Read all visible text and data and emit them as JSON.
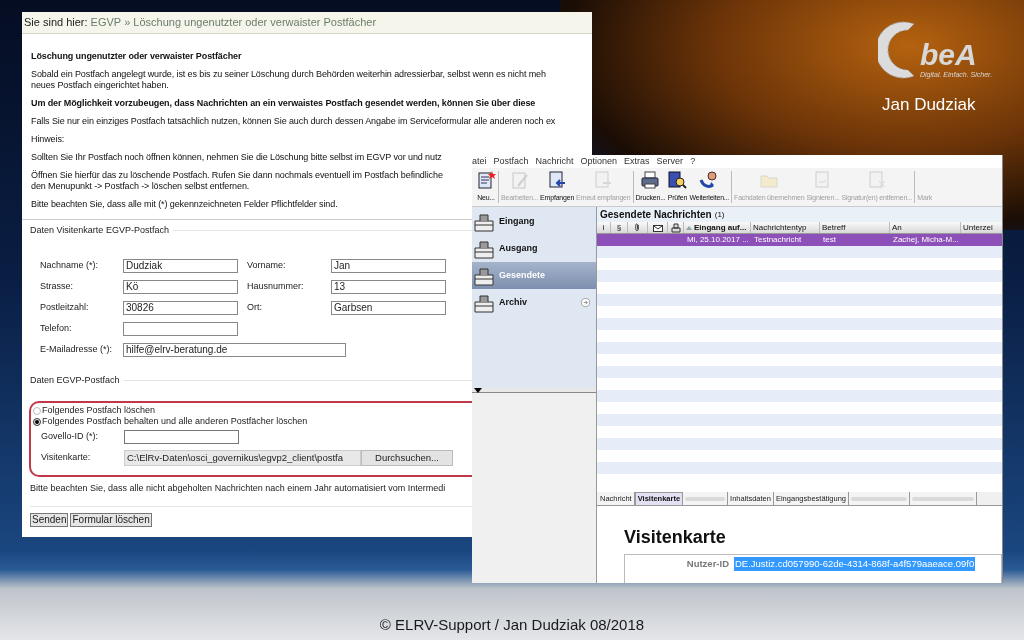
{
  "slide": {
    "logo": {
      "wordmark": "beA",
      "tagline": "Digital. Einfach. Sicher."
    },
    "author": "Jan Dudziak",
    "footer": "© ELRV-Support / Jan Dudziak 08/2018"
  },
  "browser_window": {
    "breadcrumb": {
      "prefix": "Sie sind hier:",
      "separator": "»",
      "items": [
        "EGVP",
        "Löschung ungenutzter oder verwaister Postfächer"
      ]
    },
    "paragraphs": [
      {
        "bold": true,
        "lines": [
          "Löschung ungenutzter oder verwaister Postfächer"
        ]
      },
      {
        "bold": false,
        "lines": [
          "Sobald ein Postfach angelegt wurde, ist es bis zu seiner Löschung durch Behörden weiterhin adressierbar, selbst wenn es nicht meh",
          "neues Postfach eingerichtet haben."
        ]
      },
      {
        "bold": true,
        "lines": [
          "Um der Möglichkeit vorzubeugen, dass Nachrichten an ein verwaistes Postfach gesendet werden, können Sie über diese"
        ]
      },
      {
        "bold": false,
        "lines": [
          "Falls Sie nur ein einziges Postfach tatsächlich nutzen, können Sie auch durch dessen Angabe im Serviceformular alle anderen noch ex"
        ]
      },
      {
        "bold": false,
        "lines": [
          "Hinweis:"
        ]
      },
      {
        "bold": false,
        "lines": [
          "Sollten Sie Ihr Postfach noch öffnen können, nehmen Sie die Löschung bitte selbst im EGVP vor und nutz"
        ]
      },
      {
        "bold": false,
        "lines": [
          "Öffnen Sie hierfür das zu löschende Postfach. Rufen Sie dann nochmals eventuell im Postfach befindliche",
          "den Menupunkt -> Postfach -> löschen selbst entfernen."
        ]
      },
      {
        "bold": false,
        "lines": [
          "Bitte beachten Sie, dass alle mit (*) gekennzeichneten Felder Pflichtfelder sind."
        ]
      }
    ],
    "card_section": {
      "legend": "Daten Visitenkarte EGVP-Postfach",
      "rows": [
        [
          {
            "label": "Nachname (*):",
            "value": "Dudziak"
          },
          {
            "label": "Vorname:",
            "value": "Jan"
          }
        ],
        [
          {
            "label": "Strasse:",
            "value": "Kö"
          },
          {
            "label": "Hausnummer:",
            "value": "13"
          }
        ],
        [
          {
            "label": "Postleitzahl:",
            "value": "30826"
          },
          {
            "label": "Ort:",
            "value": "Garbsen"
          }
        ],
        [
          {
            "label": "Telefon:"
          }
        ],
        [
          {
            "label": "E-Mailadresse (*):",
            "value": "hilfe@elrv-beratung.de",
            "wide": true
          }
        ]
      ]
    },
    "mailbox_section": {
      "legend": "Daten EGVP-Postfach",
      "options": [
        {
          "label": "Folgendes Postfach löschen",
          "selected": false
        },
        {
          "label": "Folgendes Postfach behalten und alle anderen Postfächer löschen",
          "selected": true
        }
      ],
      "id_field": {
        "label": "Govello-ID (*):"
      },
      "file_field": {
        "label": "Visitenkarte:",
        "value": "C:\\ElRv-Daten\\osci_governikus\\egvp2_client\\postfa",
        "button": "Durchsuchen..."
      }
    },
    "note": "Bitte beachten Sie, dass alle nicht abgeholten Nachrichten nach einem Jahr automatisiert vom Intermedi",
    "buttons": [
      "Senden",
      "Formular löschen"
    ]
  },
  "client_window": {
    "menu": [
      "atei",
      "Postfach",
      "Nachricht",
      "Optionen",
      "Extras",
      "Server",
      "?"
    ],
    "toolbar": [
      [
        {
          "label": "Neu...",
          "disabled": false
        }
      ],
      [
        {
          "label": "Bearbeiten...",
          "disabled": true
        },
        {
          "label": "Empfangen",
          "disabled": false
        },
        {
          "label": "Erneut empfangen",
          "disabled": true
        }
      ],
      [
        {
          "label": "Drucken...",
          "disabled": false
        },
        {
          "label": "Prüfen",
          "disabled": false
        },
        {
          "label": "Weiterleiten...",
          "disabled": false
        }
      ],
      [
        {
          "label": "Fachdaten übernehmen",
          "disabled": true
        },
        {
          "label": "Signieren...",
          "disabled": true
        },
        {
          "label": "Signatur(en) entfernen...",
          "disabled": true
        }
      ],
      [
        {
          "label": "Mark",
          "disabled": true
        }
      ]
    ],
    "nav": [
      {
        "label": "Eingang",
        "selected": false,
        "arrow": false
      },
      {
        "label": "Ausgang",
        "selected": false,
        "arrow": false
      },
      {
        "label": "Gesendete",
        "selected": true,
        "arrow": false
      },
      {
        "label": "Archiv",
        "selected": false,
        "arrow": true
      }
    ],
    "list": {
      "title": "Gesendete Nachrichten",
      "count": "(1)",
      "columns": [
        {
          "kind": "text",
          "label": "i",
          "sorted": false
        },
        {
          "kind": "text",
          "label": "§",
          "sorted": false
        },
        {
          "kind": "clip"
        },
        {
          "kind": "envelope"
        },
        {
          "kind": "stamp"
        },
        {
          "kind": "text",
          "label": "Eingang auf...",
          "sorted": true
        },
        {
          "kind": "text",
          "label": "Nachrichtentyp",
          "sorted": false
        },
        {
          "kind": "text",
          "label": "Betreff",
          "sorted": false
        },
        {
          "kind": "text",
          "label": "An",
          "sorted": false
        },
        {
          "kind": "text",
          "label": "Unterzei",
          "sorted": false
        }
      ],
      "rows": [
        {
          "cells": [
            "",
            "",
            "",
            "",
            "",
            "Mi, 25.10.2017 ...",
            "Testnachricht",
            "test",
            "Zachej, Micha-M..."
          ],
          "selected": true
        }
      ]
    },
    "tabs": [
      {
        "label": "Nachricht",
        "selected": false,
        "disabled": false
      },
      {
        "label": "Visitenkarte",
        "selected": true,
        "disabled": false
      },
      {
        "selected": false,
        "disabled": true
      },
      {
        "label": "Inhaltsdaten",
        "selected": false,
        "disabled": false
      },
      {
        "label": "Eingangsbestätigung",
        "selected": false,
        "disabled": false
      },
      {
        "selected": false,
        "disabled": true
      },
      {
        "selected": false,
        "disabled": true
      }
    ],
    "detail": {
      "heading": "Visitenkarte",
      "fields": [
        {
          "label": "Nutzer-ID",
          "value": "DE.Justiz.cd057990-62de-4314-868f-a4f579aaeace.09f0",
          "selected": true
        }
      ]
    }
  }
}
